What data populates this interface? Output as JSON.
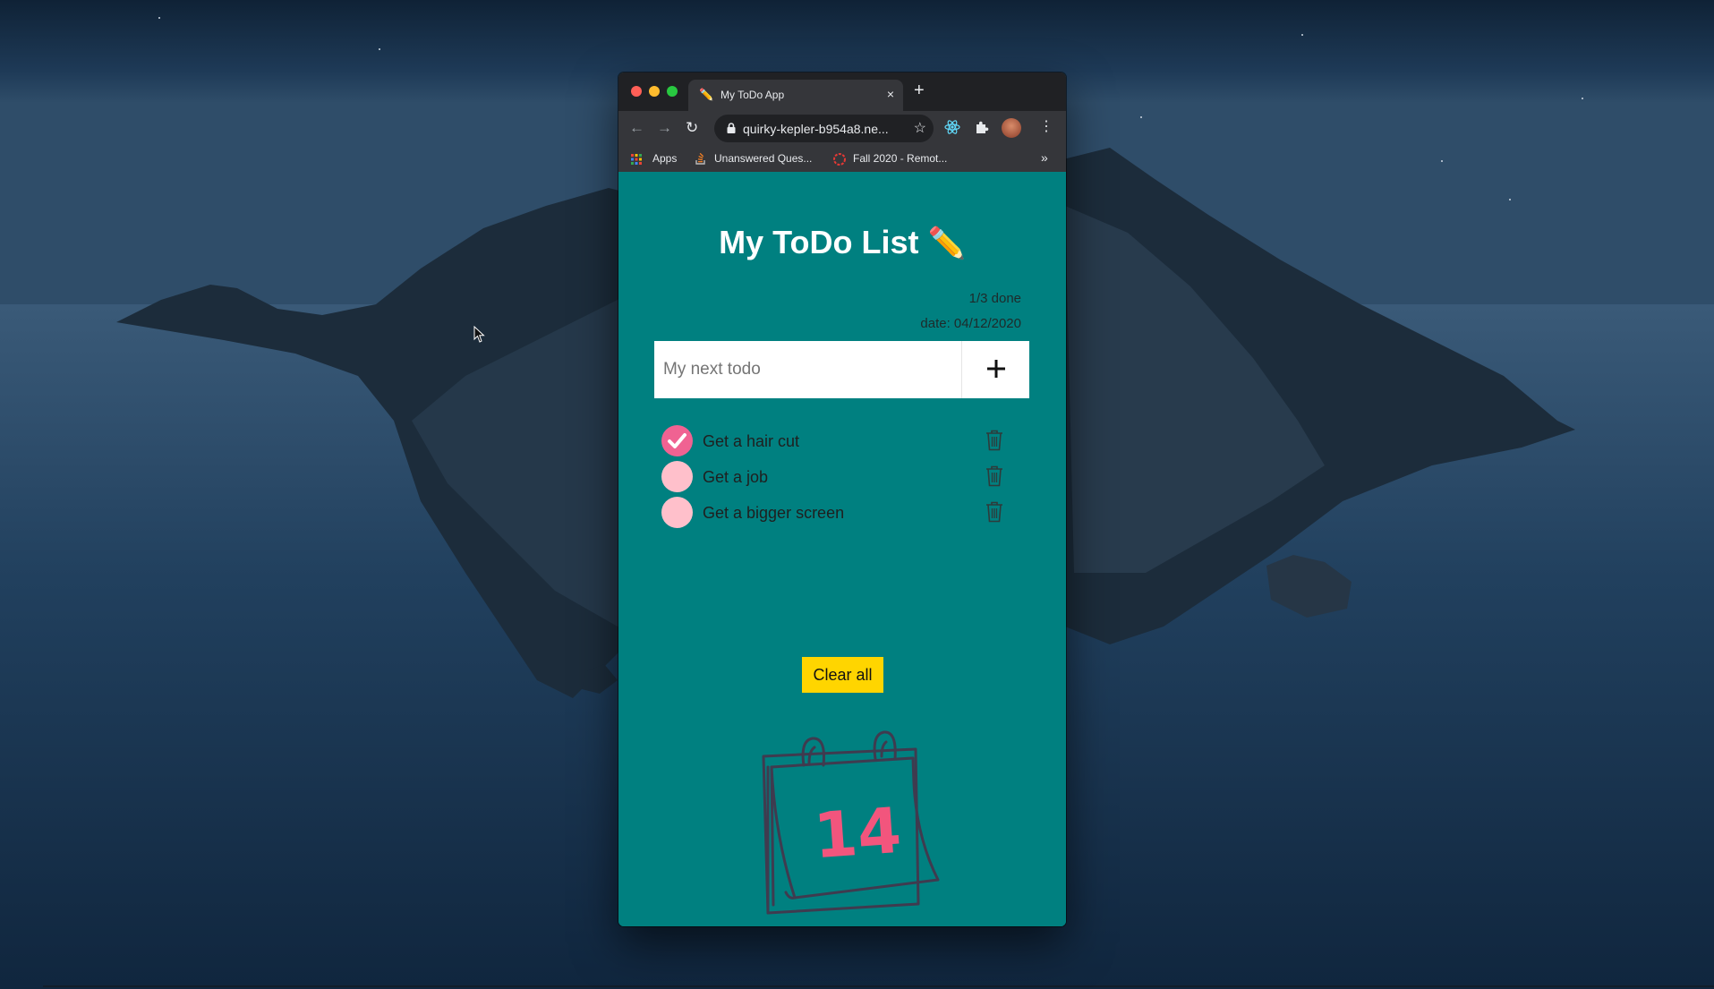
{
  "browser": {
    "tab_favicon": "✏️",
    "tab_title": "My ToDo App",
    "tab_close": "×",
    "new_tab": "+",
    "url": "quirky-kepler-b954a8.ne...",
    "bookmarks": {
      "apps": "Apps",
      "unanswered": "Unanswered Ques...",
      "fall": "Fall 2020 - Remot...",
      "more": "»"
    },
    "icons": [
      "back-arrow-icon",
      "forward-arrow-icon",
      "reload-icon",
      "lock-icon",
      "star-icon",
      "react-devtools-icon",
      "extensions-puzzle-icon",
      "profile-avatar",
      "kebab-menu-icon",
      "apps-grid-icon",
      "stackoverflow-icon"
    ]
  },
  "app": {
    "title": "My ToDo List",
    "title_emoji": "✏️",
    "done_count": "1/3 done",
    "date": "date: 04/12/2020",
    "input_placeholder": "My next todo",
    "input_value": "",
    "add_label": "+",
    "todos": [
      {
        "text": "Get a hair cut",
        "done": true
      },
      {
        "text": "Get a job",
        "done": false
      },
      {
        "text": "Get a bigger screen",
        "done": false
      }
    ],
    "clear_label": "Clear all",
    "calendar_number": "14"
  },
  "colors": {
    "page_background": "#008080",
    "checked": "#f06292",
    "unchecked": "#ffc0cb",
    "clear_button": "#ffd500",
    "illustration_number": "#f2557d"
  }
}
